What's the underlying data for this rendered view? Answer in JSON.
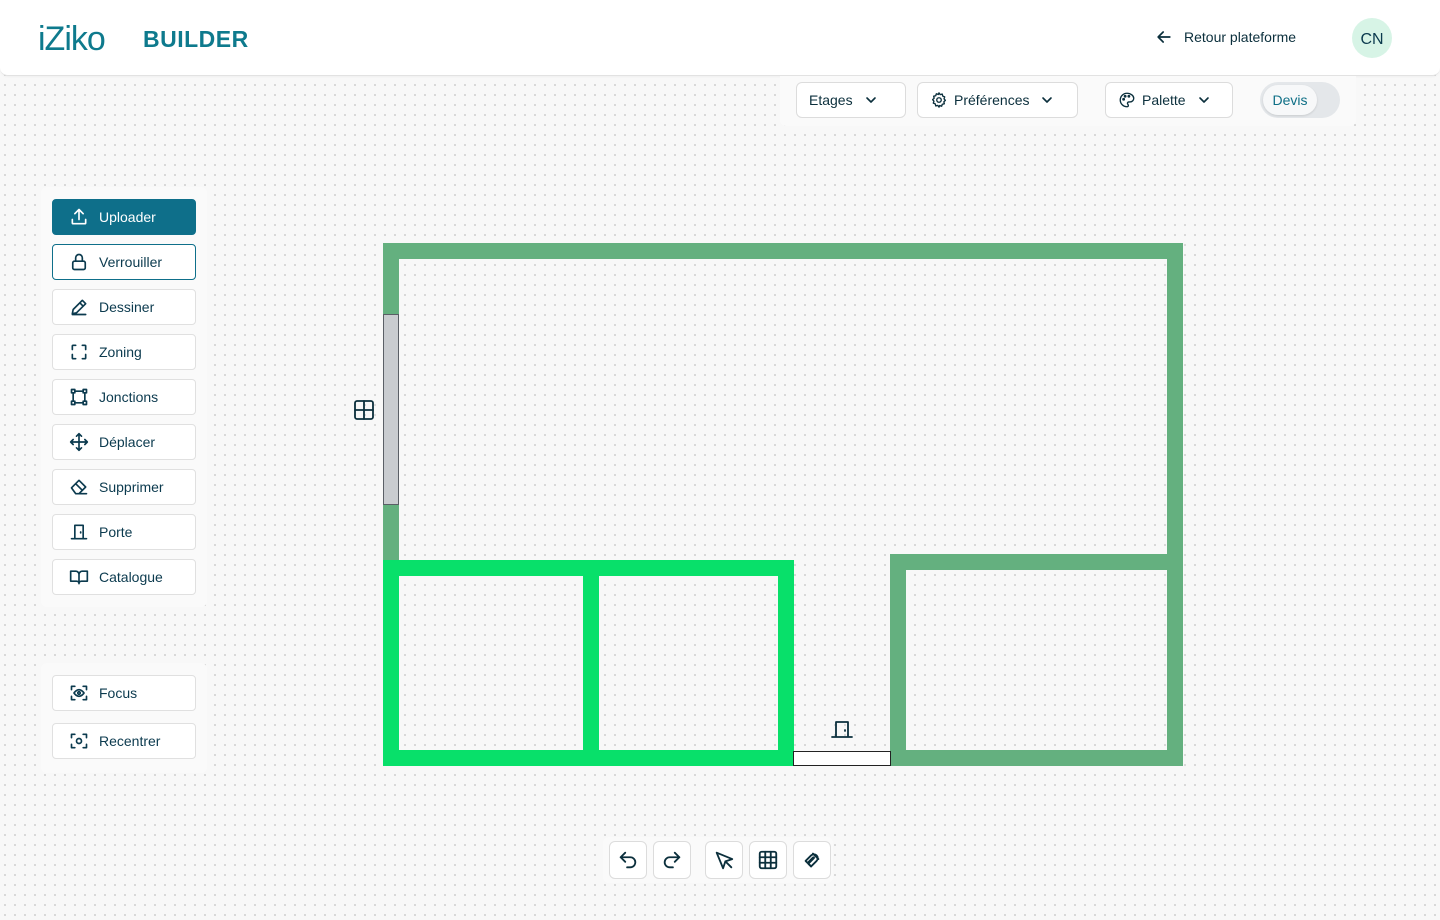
{
  "header": {
    "logo_text": "iZiko",
    "app_title": "BUILDER",
    "back_label": "Retour plateforme",
    "avatar_initials": "CN"
  },
  "topbar": {
    "floors_label": "Etages",
    "preferences_label": "Préférences",
    "palette_label": "Palette",
    "quote_toggle_label": "Devis"
  },
  "tools": {
    "upload": "Uploader",
    "lock": "Verrouiller",
    "draw": "Dessiner",
    "zoning": "Zoning",
    "junctions": "Jonctions",
    "move": "Déplacer",
    "delete": "Supprimer",
    "door": "Porte",
    "catalog": "Catalogue"
  },
  "view_tools": {
    "focus": "Focus",
    "recenter": "Recentrer"
  },
  "colors": {
    "primary": "#0e6f8a",
    "wall_default": "#64b07f",
    "wall_selected": "#08e06a",
    "avatar_bg": "#d7f4e6"
  }
}
